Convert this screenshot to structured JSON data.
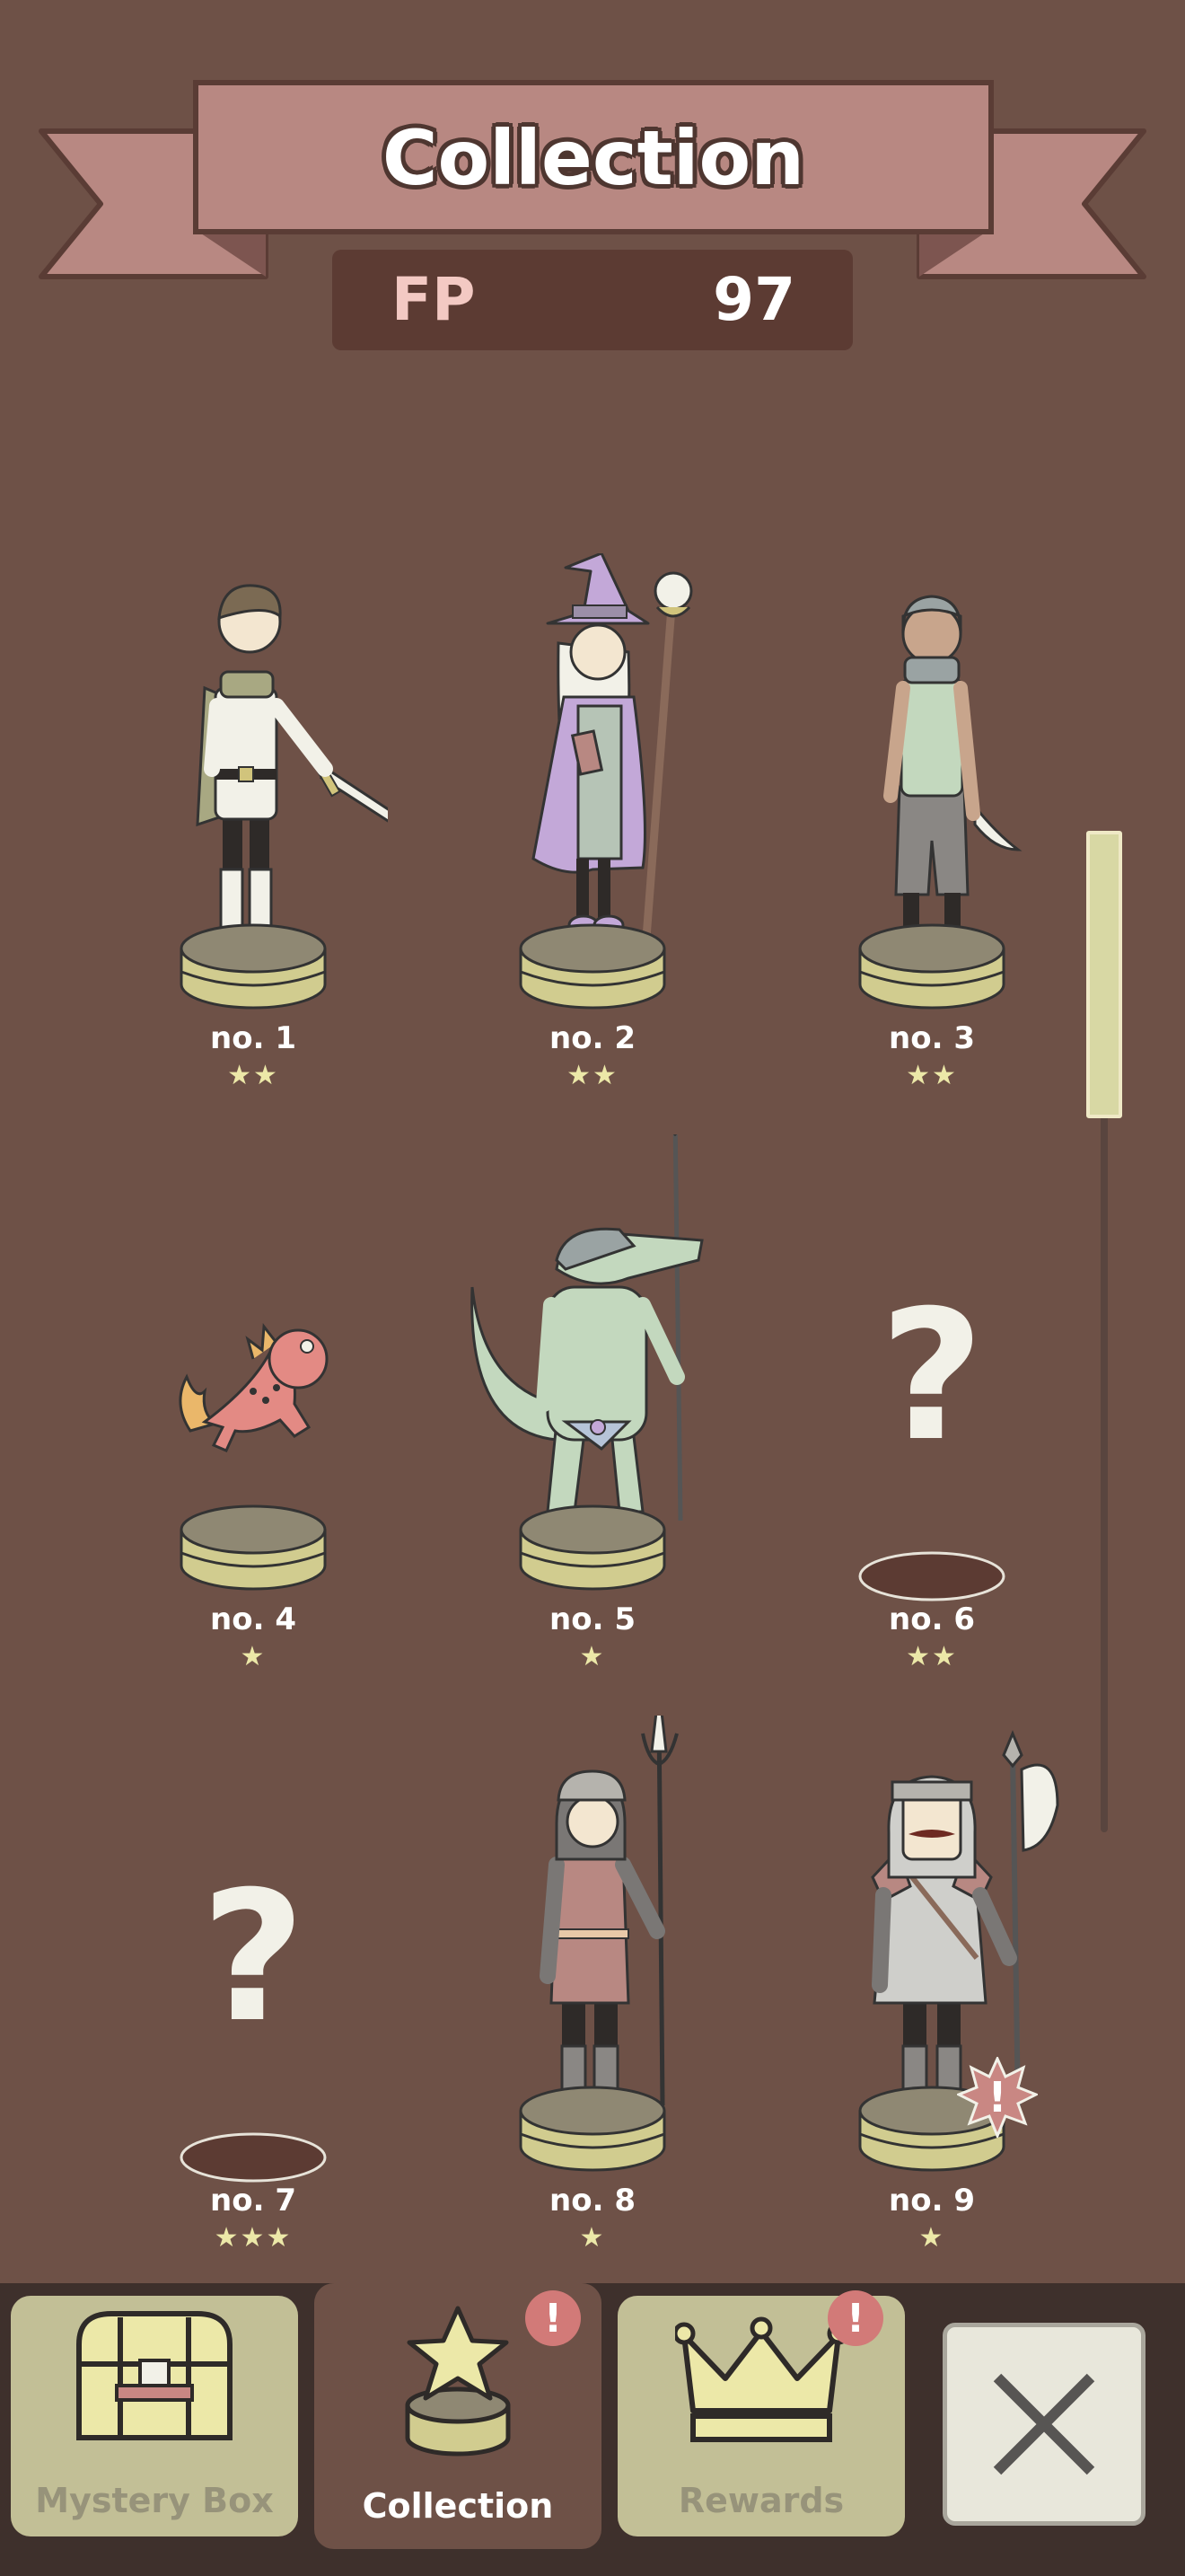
{
  "header": {
    "title": "Collection",
    "fp_label": "FP",
    "fp_value": "97"
  },
  "figures": [
    {
      "number": "no. 1",
      "stars": "★★",
      "rating": 2,
      "unlocked": true
    },
    {
      "number": "no. 2",
      "stars": "★★",
      "rating": 2,
      "unlocked": true
    },
    {
      "number": "no. 3",
      "stars": "★★",
      "rating": 2,
      "unlocked": true
    },
    {
      "number": "no. 4",
      "stars": "★",
      "rating": 1,
      "unlocked": true
    },
    {
      "number": "no. 5",
      "stars": "★",
      "rating": 1,
      "unlocked": true
    },
    {
      "number": "no. 6",
      "stars": "★★",
      "rating": 2,
      "unlocked": false,
      "placeholder": "?"
    },
    {
      "number": "no. 7",
      "stars": "★★★",
      "rating": 3,
      "unlocked": false,
      "placeholder": "?"
    },
    {
      "number": "no. 8",
      "stars": "★",
      "rating": 1,
      "unlocked": true
    },
    {
      "number": "no. 9",
      "stars": "★",
      "rating": 1,
      "unlocked": true,
      "alert": "!"
    }
  ],
  "tabs": [
    {
      "label": "Mystery Box",
      "icon": "chest-icon",
      "active": false
    },
    {
      "label": "Collection",
      "icon": "star-trophy-icon",
      "active": true,
      "badge": "!"
    },
    {
      "label": "Rewards",
      "icon": "crown-icon",
      "active": false,
      "badge": "!"
    }
  ],
  "close": {
    "icon": "close-icon"
  },
  "colors": {
    "background": "#6e5147",
    "banner": "#b88882",
    "fp_box": "#5c3b33",
    "pedestal": "#d1cc8f",
    "star": "#ece8a8",
    "badge": "#d27a78"
  }
}
